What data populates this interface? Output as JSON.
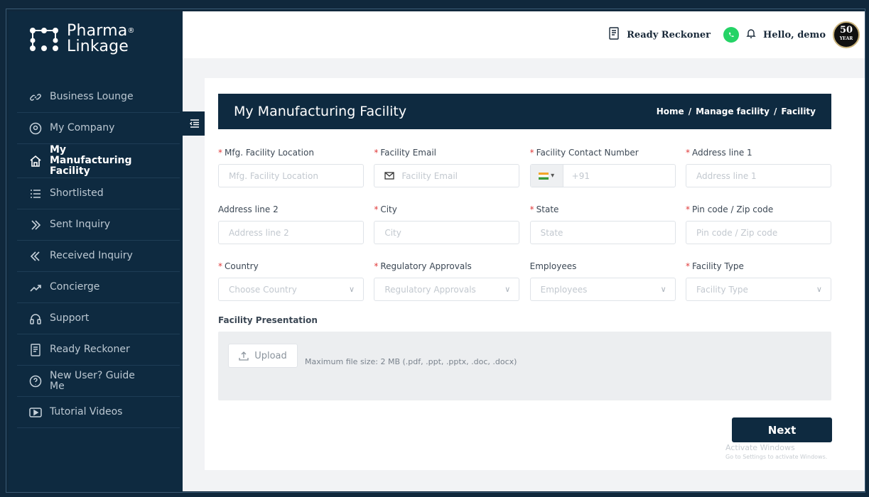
{
  "brand": {
    "line1": "Pharma",
    "line2": "Linkage",
    "reg": "®"
  },
  "sidebar": {
    "items": [
      {
        "label": "Business Lounge",
        "icon": "link-icon",
        "active": false
      },
      {
        "label": "My Company",
        "icon": "location-pin-icon",
        "active": false
      },
      {
        "label": "My Manufacturing Facility",
        "icon": "home-icon",
        "active": true
      },
      {
        "label": "Shortlisted",
        "icon": "list-icon",
        "active": false
      },
      {
        "label": "Sent Inquiry",
        "icon": "double-chevron-right-icon",
        "active": false
      },
      {
        "label": "Received Inquiry",
        "icon": "double-chevron-left-icon",
        "active": false
      },
      {
        "label": "Concierge",
        "icon": "trend-line-icon",
        "active": false
      },
      {
        "label": "Support",
        "icon": "headset-icon",
        "active": false
      },
      {
        "label": "Ready Reckoner",
        "icon": "receipt-icon",
        "active": false
      },
      {
        "label": "New User? Guide Me",
        "icon": "help-circle-icon",
        "active": false
      },
      {
        "label": "Tutorial Videos",
        "icon": "play-video-icon",
        "active": false
      }
    ]
  },
  "topbar": {
    "ready_reckoner": "Ready Reckoner",
    "greeting": "Hello, demo",
    "badge_number": "50",
    "badge_small": "YEAR"
  },
  "page": {
    "title": "My Manufacturing Facility",
    "breadcrumb": {
      "home": "Home",
      "sep": "/",
      "mid": "Manage facility",
      "current": "Facility"
    }
  },
  "form": {
    "mfg_location": {
      "label": "Mfg. Facility Location",
      "placeholder": "Mfg. Facility Location",
      "required": "*"
    },
    "email": {
      "label": "Facility Email",
      "placeholder": "Facility Email",
      "required": "*"
    },
    "contact": {
      "label": "Facility Contact Number",
      "code": "+91",
      "required": "*"
    },
    "address1": {
      "label": "Address line 1",
      "placeholder": "Address line 1",
      "required": "*"
    },
    "address2": {
      "label": "Address line 2",
      "placeholder": "Address line 2"
    },
    "city": {
      "label": "City",
      "placeholder": "City",
      "required": "*"
    },
    "state": {
      "label": "State",
      "placeholder": "State",
      "required": "*"
    },
    "pincode": {
      "label": "Pin code / Zip code",
      "placeholder": "Pin code / Zip code",
      "required": "*"
    },
    "country": {
      "label": "Country",
      "placeholder": "Choose Country",
      "required": "*"
    },
    "regulatory": {
      "label": "Regulatory Approvals",
      "placeholder": "Regulatory Approvals",
      "required": "*"
    },
    "employees": {
      "label": "Employees",
      "placeholder": "Employees"
    },
    "facility_type": {
      "label": "Facility Type",
      "placeholder": "Facility Type",
      "required": "*"
    },
    "presentation": {
      "label": "Facility Presentation",
      "upload_label": "Upload",
      "hint": "Maximum file size: 2 MB (.pdf, .ppt, .pptx, .doc, .docx)"
    },
    "next_label": "Next"
  },
  "windows_watermark": {
    "line1": "Activate Windows",
    "line2": "Go to Settings to activate Windows."
  },
  "colors": {
    "navy": "#0e2a40",
    "required": "#e03a3a",
    "whatsapp": "#25d366"
  }
}
